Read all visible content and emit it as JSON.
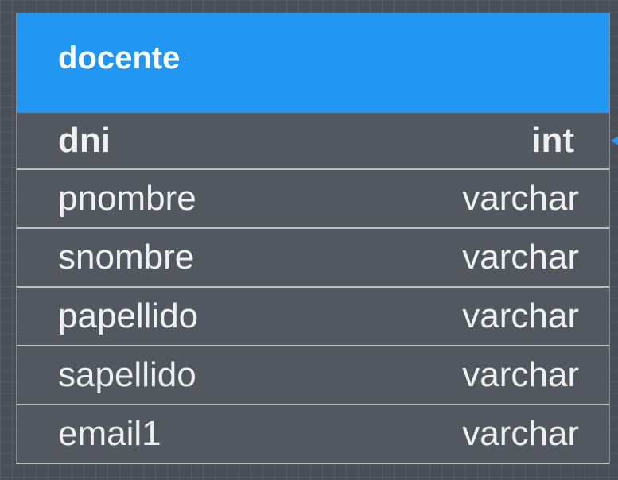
{
  "table": {
    "name": "docente",
    "header_color": "#2196f3",
    "fields": [
      {
        "name": "dni",
        "type": "int",
        "primary_key": true
      },
      {
        "name": "pnombre",
        "type": "varchar"
      },
      {
        "name": "snombre",
        "type": "varchar"
      },
      {
        "name": "papellido",
        "type": "varchar"
      },
      {
        "name": "sapellido",
        "type": "varchar"
      },
      {
        "name": "email1",
        "type": "varchar"
      }
    ]
  }
}
